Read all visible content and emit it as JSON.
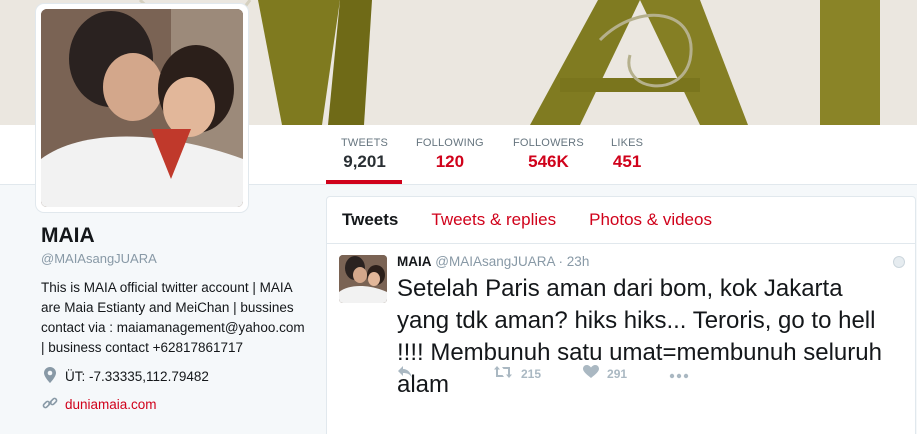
{
  "stats": [
    {
      "label": "TWEETS",
      "value": "9,201"
    },
    {
      "label": "FOLLOWING",
      "value": "120"
    },
    {
      "label": "FOLLOWERS",
      "value": "546K"
    },
    {
      "label": "LIKES",
      "value": "451"
    }
  ],
  "profile": {
    "name": "MAIA",
    "handle": "@MAIAsangJUARA",
    "bio": "This is MAIA official twitter account | MAIA are Maia Estianty and MeiChan | bussines contact via : maiamanagement@yahoo.com | business contact +62817861717",
    "location": "ÜT: -7.33335,112.79482",
    "website": "duniamaia.com"
  },
  "tabs": [
    "Tweets",
    "Tweets & replies",
    "Photos & videos"
  ],
  "tweet": {
    "name": "MAIA",
    "handle": "@MAIAsangJUARA",
    "sep": "·",
    "time": "23h",
    "text": "Setelah Paris aman dari bom, kok Jakarta yang tdk aman? hiks hiks... Teroris, go to hell !!!! Membunuh satu umat=membunuh seluruh alam",
    "retweets": "215",
    "likes": "291"
  },
  "icons": {
    "location": "map-pin-icon",
    "link": "link-icon",
    "reply": "reply-icon",
    "retweet": "retweet-icon",
    "like": "heart-icon",
    "more": "more-icon"
  },
  "colors": {
    "accent": "#d0021b",
    "banner_letters": "#827a1d"
  }
}
